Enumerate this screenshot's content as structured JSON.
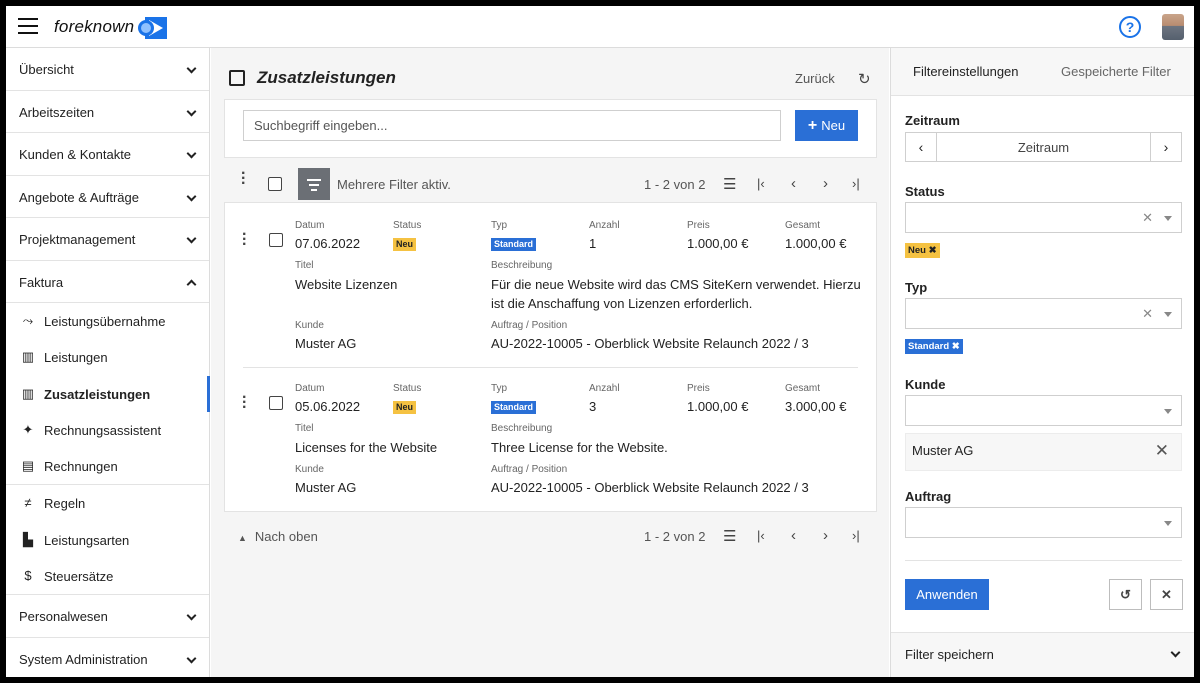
{
  "app": {
    "brand": "foreknown"
  },
  "sidebar": {
    "sections": [
      {
        "label": "Übersicht"
      },
      {
        "label": "Arbeitszeiten"
      },
      {
        "label": "Kunden & Kontakte"
      },
      {
        "label": "Angebote & Aufträge"
      },
      {
        "label": "Projektmanagement"
      },
      {
        "label": "Faktura"
      }
    ],
    "faktura_items": [
      {
        "label": "Leistungsübernahme",
        "icon": "wizard-icon"
      },
      {
        "label": "Leistungen",
        "icon": "chart-box-icon"
      },
      {
        "label": "Zusatzleistungen",
        "icon": "chart-plus-icon"
      },
      {
        "label": "Rechnungsassistent",
        "icon": "magic-wand-icon"
      },
      {
        "label": "Rechnungen",
        "icon": "receipt-icon"
      }
    ],
    "faktura_settings": [
      {
        "label": "Regeln",
        "icon": "rules-icon"
      },
      {
        "label": "Leistungsarten",
        "icon": "bar-chart-icon"
      },
      {
        "label": "Steuersätze",
        "icon": "dollar-icon"
      }
    ],
    "bottom_sections": [
      {
        "label": "Personalwesen"
      },
      {
        "label": "System Administration"
      }
    ]
  },
  "main": {
    "title": "Zusatzleistungen",
    "back": "Zurück",
    "search_placeholder": "Suchbegriff eingeben...",
    "new_button": "Neu",
    "filter_status": "Mehrere Filter aktiv.",
    "pager": "1 - 2 von 2",
    "to_top": "Nach oben",
    "captions": {
      "datum": "Datum",
      "status": "Status",
      "typ": "Typ",
      "anzahl": "Anzahl",
      "preis": "Preis",
      "gesamt": "Gesamt",
      "titel": "Titel",
      "beschreibung": "Beschreibung",
      "kunde": "Kunde",
      "auftrag": "Auftrag / Position"
    },
    "items": [
      {
        "datum": "07.06.2022",
        "status": "Neu",
        "typ": "Standard",
        "anzahl": "1",
        "preis": "1.000,00 €",
        "gesamt": "1.000,00 €",
        "titel": "Website Lizenzen",
        "beschreibung_1": "Für die neue Website wird das CMS SiteKern verwendet. Hierzu",
        "beschreibung_2": "ist die Anschaffung von Lizenzen erforderlich.",
        "kunde": "Muster AG",
        "auftrag": "AU-2022-10005 - Oberblick Website Relaunch 2022 / 3"
      },
      {
        "datum": "05.06.2022",
        "status": "Neu",
        "typ": "Standard",
        "anzahl": "3",
        "preis": "1.000,00 €",
        "gesamt": "3.000,00 €",
        "titel": "Licenses for the Website",
        "beschreibung_1": "Three License for the Website.",
        "beschreibung_2": "",
        "kunde": "Muster AG",
        "auftrag": "AU-2022-10005 - Oberblick Website Relaunch 2022 / 3"
      }
    ]
  },
  "filters": {
    "tab_settings": "Filtereinstellungen",
    "tab_saved": "Gespeicherte Filter",
    "zeitraum_label": "Zeitraum",
    "zeitraum_value": "Zeitraum",
    "status_label": "Status",
    "status_chip": "Neu ✖",
    "typ_label": "Typ",
    "typ_chip": "Standard ✖",
    "kunde_label": "Kunde",
    "kunde_value": "Muster AG",
    "auftrag_label": "Auftrag",
    "apply": "Anwenden",
    "save_filter": "Filter speichern"
  },
  "colors": {
    "accent": "#2a6fd6",
    "badge_new": "#f5c242"
  }
}
